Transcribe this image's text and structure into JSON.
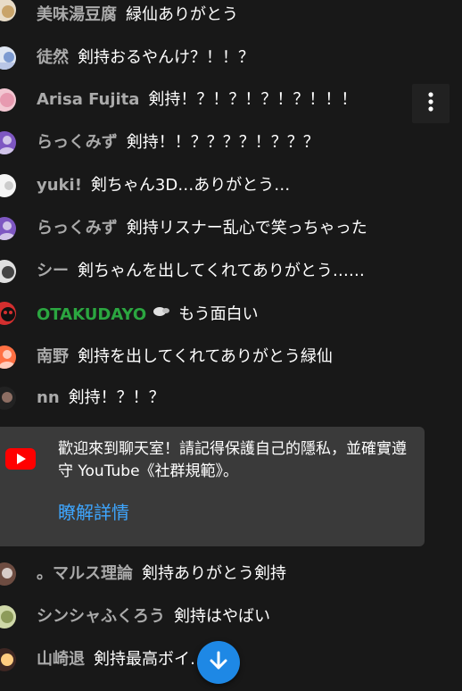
{
  "messages": [
    {
      "author": "美味湯豆腐",
      "text": "緑仙ありがとう"
    },
    {
      "author": "徒然",
      "text": "剣持おるやんけ？！！？"
    },
    {
      "author": "Arisa Fujita",
      "text": "剣持！？！？！？！？！！！"
    },
    {
      "author": "らっくみず",
      "text": "剣持！！？？？？！？？？"
    },
    {
      "author": "yuki!",
      "text": "剣ちゃん3D…ありがとう…"
    },
    {
      "author": "らっくみず",
      "text": "剣持リスナー乱心で笑っちゃった"
    },
    {
      "author": "シー",
      "text": "剣ちゃんを出してくれてありがとう……"
    },
    {
      "author": "OTAKUDAYO",
      "text": "もう面白い"
    },
    {
      "author": "南野",
      "text": "剣持を出してくれてありがとう緑仙"
    },
    {
      "author": "nn",
      "text": "剣持！？！？"
    },
    {
      "author": "。マルス理論",
      "text": "剣持ありがとう剣持"
    },
    {
      "author": "シンシャふくろう",
      "text": "剣持はやばい"
    },
    {
      "author": "山崎退",
      "text": "剣持最高ボイ…出せ"
    }
  ],
  "welcome": {
    "text": "歡迎來到聊天室！請記得保護自己的隱私，並確實遵守 YouTube《社群規範》。",
    "link": "瞭解詳情"
  },
  "colors": {
    "background": "#181818",
    "author": "#aaaaaa",
    "member_author": "#2ba640",
    "link": "#3ea6ff",
    "scroll_button": "#1e88e5"
  }
}
